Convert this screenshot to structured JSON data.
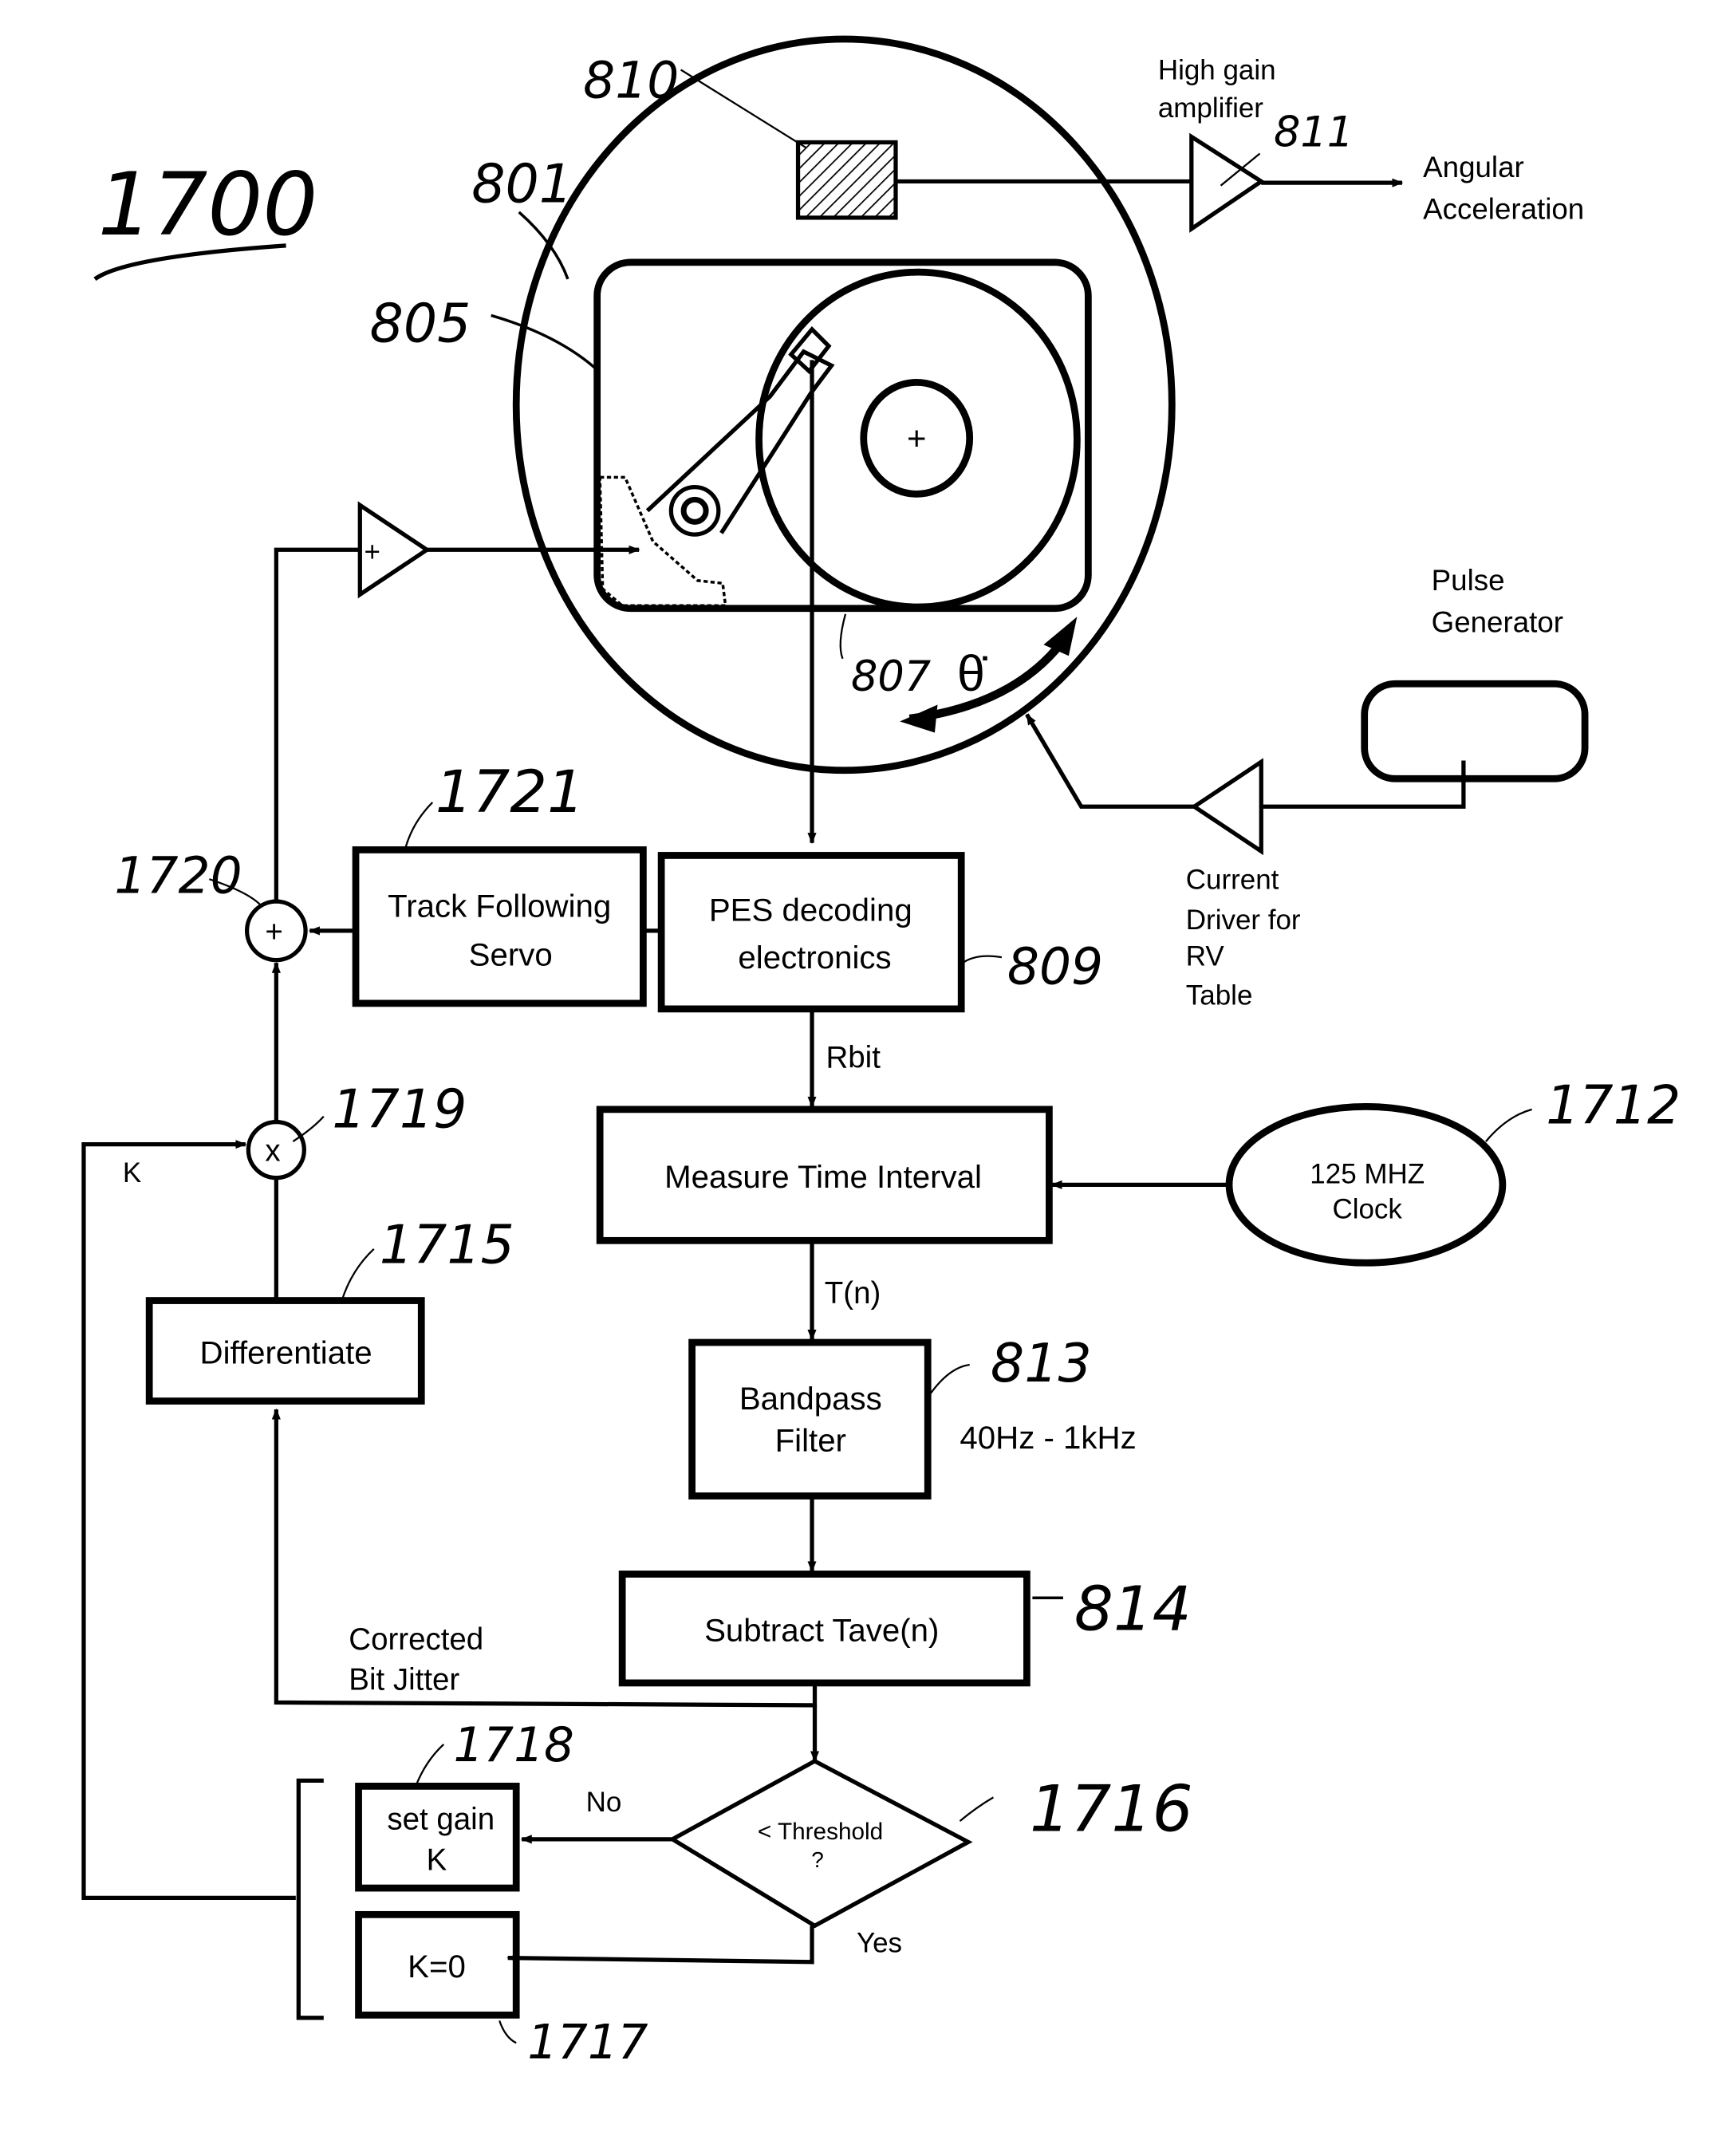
{
  "figure": {
    "number": "1700",
    "colors": {
      "ink": "#000000",
      "paper": "#ffffff"
    }
  },
  "refs": {
    "r810": "810",
    "r801": "801",
    "r805": "805",
    "r811": "811",
    "r807": "807",
    "r1721": "1721",
    "r1720": "1720",
    "r809": "809",
    "r1719": "1719",
    "r1712": "1712",
    "r1715": "1715",
    "r813": "813",
    "r814": "814",
    "r1718": "1718",
    "r1716": "1716",
    "r1717": "1717"
  },
  "labels": {
    "high_gain_1": "High gain",
    "high_gain_2": "amplifier",
    "angular_1": "Angular",
    "angular_2": "Acceleration",
    "pulse_1": "Pulse",
    "pulse_2": "Generator",
    "driver_1": "Current",
    "driver_2": "Driver for",
    "driver_3": "RV",
    "driver_4": "Table",
    "theta_dot": "θ̇",
    "plus_sign": "+",
    "times_sign": "x",
    "k_signal": "K",
    "rbit": "Rbit",
    "tn": "T(n)",
    "bandpass_range": "40Hz - 1kHz",
    "corrected_1": "Corrected",
    "corrected_2": "Bit  Jitter",
    "no": "No",
    "yes": "Yes"
  },
  "blocks": {
    "track_following_1": "Track Following",
    "track_following_2": "Servo",
    "pes_1": "PES decoding",
    "pes_2": "electronics",
    "measure": "Measure Time Interval",
    "clock_1": "125 MHZ",
    "clock_2": "Clock",
    "differentiate": "Differentiate",
    "bandpass_1": "Bandpass",
    "bandpass_2": "Filter",
    "subtract": "Subtract Tave(n)",
    "threshold_1": "< Threshold",
    "threshold_2": "?",
    "set_gain_1": "set gain",
    "set_gain_2": "K",
    "k_zero": "K=0"
  }
}
